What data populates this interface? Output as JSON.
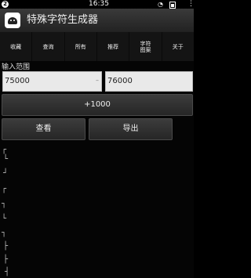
{
  "status_bar": {
    "notification_count": "2",
    "time": "16:35",
    "wifi_icon": "wifi-icon",
    "battery_icon": "battery-icon",
    "menu_icon": "menu-icon"
  },
  "action_bar": {
    "title": "特殊字符生成器",
    "app_icon": "android-robot-icon"
  },
  "tabs": [
    {
      "label": "收藏"
    },
    {
      "label": "查询"
    },
    {
      "label": "所有"
    },
    {
      "label": "推荐"
    },
    {
      "label": "字符\n图案"
    },
    {
      "label": "关于"
    }
  ],
  "range": {
    "label": "输入范围",
    "from_value": "75000",
    "to_value": "76000",
    "separator": "–"
  },
  "buttons": {
    "increment_label": "+1000",
    "view_label": "查看",
    "export_label": "导出"
  },
  "glyphs": [
    "┌",
    "└",
    "┘",
    "┌",
    "┐",
    "└",
    "┐",
    "├",
    "├",
    "┤"
  ]
}
